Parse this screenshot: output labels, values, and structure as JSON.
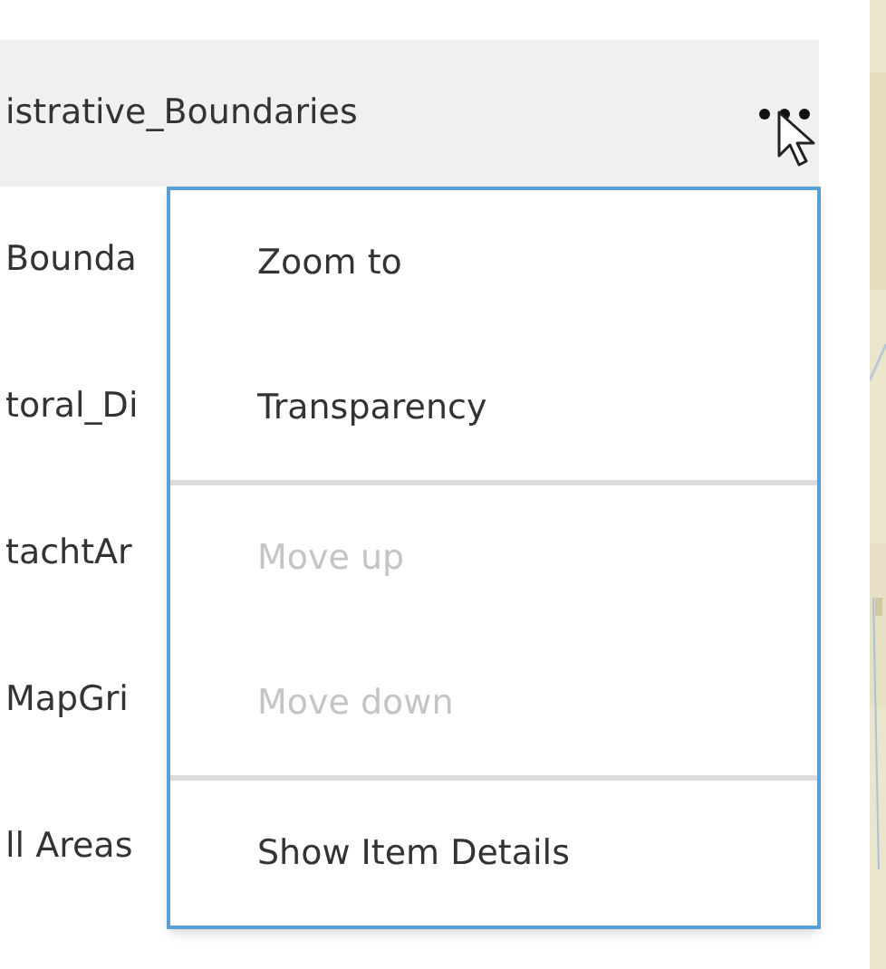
{
  "layers": [
    {
      "name": "istrative_Boundaries",
      "highlighted": true
    },
    {
      "name": "Bounda",
      "highlighted": false
    },
    {
      "name": "toral_Di",
      "highlighted": false
    },
    {
      "name": "tachtAr",
      "highlighted": false
    },
    {
      "name": "MapGri",
      "highlighted": false
    },
    {
      "name": "ll Areas",
      "highlighted": false
    }
  ],
  "menu": {
    "groups": [
      [
        {
          "label": "Zoom to",
          "disabled": false
        },
        {
          "label": "Transparency",
          "disabled": false
        }
      ],
      [
        {
          "label": "Move up",
          "disabled": true
        },
        {
          "label": "Move down",
          "disabled": true
        }
      ],
      [
        {
          "label": "Show Item Details",
          "disabled": false
        }
      ]
    ]
  }
}
